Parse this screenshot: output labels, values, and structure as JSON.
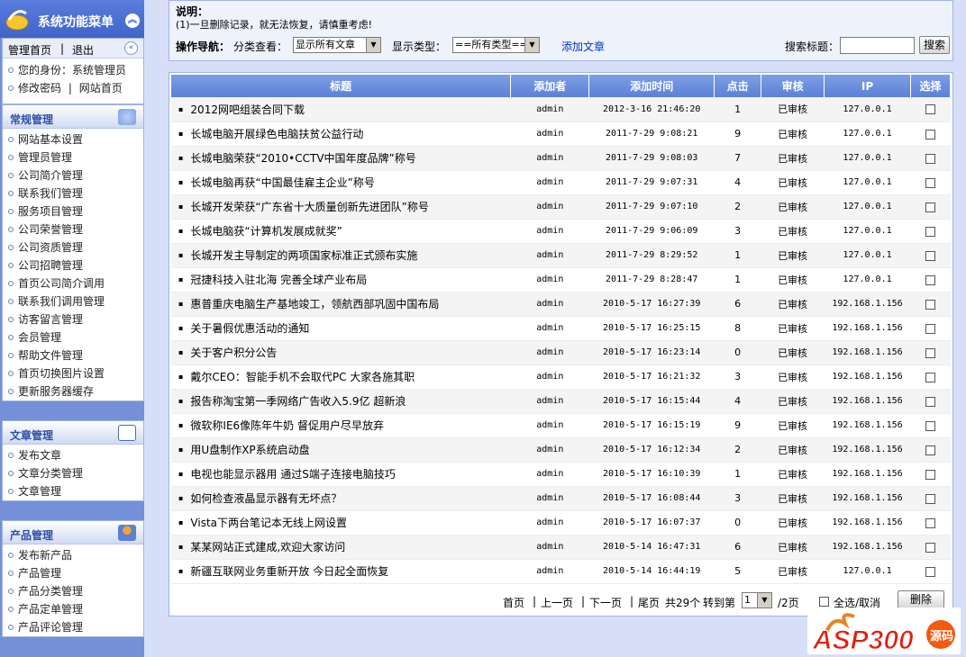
{
  "sidebar": {
    "title": "系统功能菜单",
    "user_nav": {
      "home": "管理首页",
      "sep": "|",
      "logout": "退出"
    },
    "identity": "您的身份：系统管理员",
    "change_pw": "修改密码",
    "sep": "|",
    "site_home": "网站首页",
    "panels": [
      {
        "title": "常规管理",
        "items": [
          "网站基本设置",
          "管理员管理",
          "公司简介管理",
          "联系我们管理",
          "服务项目管理",
          "公司荣誉管理",
          "公司资质管理",
          "公司招聘管理",
          "首页公司简介调用",
          "联系我们调用管理",
          "访客留言管理",
          "会员管理",
          "帮助文件管理",
          "首页切换图片设置",
          "更新服务器缓存"
        ]
      },
      {
        "title": "文章管理",
        "items": [
          "发布文章",
          "文章分类管理",
          "文章管理"
        ]
      },
      {
        "title": "产品管理",
        "items": [
          "发布新产品",
          "产品管理",
          "产品分类管理",
          "产品定单管理",
          "产品评论管理"
        ]
      }
    ]
  },
  "notice": {
    "title": "说明：",
    "text": "(1)一旦删除记录，就无法恢复，请慎重考虑!"
  },
  "toolbar": {
    "nav_label": "操作导航：",
    "category_label": "分类查看：",
    "category_value": "显示所有文章",
    "type_label": "显示类型：",
    "type_value": "==所有类型==",
    "add_link": "添加文章",
    "search_label": "搜索标题：",
    "search_value": "",
    "search_button": "搜索"
  },
  "table": {
    "headers": [
      "标题",
      "添加者",
      "添加时间",
      "点击",
      "审核",
      "IP",
      "选择"
    ],
    "rows": [
      {
        "title": "2012网吧组装合同下载",
        "author": "admin",
        "time": "2012-3-16 21:46:20",
        "clicks": "1",
        "status": "已审核",
        "ip": "127.0.0.1"
      },
      {
        "title": "长城电脑开展绿色电脑扶贫公益行动",
        "author": "admin",
        "time": "2011-7-29 9:08:21",
        "clicks": "9",
        "status": "已审核",
        "ip": "127.0.0.1"
      },
      {
        "title": "长城电脑荣获“2010•CCTV中国年度品牌”称号",
        "author": "admin",
        "time": "2011-7-29 9:08:03",
        "clicks": "7",
        "status": "已审核",
        "ip": "127.0.0.1"
      },
      {
        "title": "长城电脑再获“中国最佳雇主企业”称号",
        "author": "admin",
        "time": "2011-7-29 9:07:31",
        "clicks": "4",
        "status": "已审核",
        "ip": "127.0.0.1"
      },
      {
        "title": "长城开发荣获“广东省十大质量创新先进团队”称号",
        "author": "admin",
        "time": "2011-7-29 9:07:10",
        "clicks": "2",
        "status": "已审核",
        "ip": "127.0.0.1"
      },
      {
        "title": "长城电脑获“计算机发展成就奖”",
        "author": "admin",
        "time": "2011-7-29 9:06:09",
        "clicks": "3",
        "status": "已审核",
        "ip": "127.0.0.1"
      },
      {
        "title": "长城开发主导制定的两项国家标准正式颁布实施",
        "author": "admin",
        "time": "2011-7-29 8:29:52",
        "clicks": "1",
        "status": "已审核",
        "ip": "127.0.0.1"
      },
      {
        "title": "冠捷科技入驻北海 完善全球产业布局",
        "author": "admin",
        "time": "2011-7-29 8:28:47",
        "clicks": "1",
        "status": "已审核",
        "ip": "127.0.0.1"
      },
      {
        "title": "惠普重庆电脑生产基地竣工，领航西部巩固中国布局",
        "author": "admin",
        "time": "2010-5-17 16:27:39",
        "clicks": "6",
        "status": "已审核",
        "ip": "192.168.1.156"
      },
      {
        "title": "关于暑假优惠活动的通知",
        "author": "admin",
        "time": "2010-5-17 16:25:15",
        "clicks": "8",
        "status": "已审核",
        "ip": "192.168.1.156"
      },
      {
        "title": "关于客户积分公告",
        "author": "admin",
        "time": "2010-5-17 16:23:14",
        "clicks": "0",
        "status": "已审核",
        "ip": "192.168.1.156"
      },
      {
        "title": "戴尔CEO：智能手机不会取代PC 大家各施其职",
        "author": "admin",
        "time": "2010-5-17 16:21:32",
        "clicks": "3",
        "status": "已审核",
        "ip": "192.168.1.156"
      },
      {
        "title": "报告称淘宝第一季网络广告收入5.9亿 超新浪",
        "author": "admin",
        "time": "2010-5-17 16:15:44",
        "clicks": "4",
        "status": "已审核",
        "ip": "192.168.1.156"
      },
      {
        "title": "微软称IE6像陈年牛奶 督促用户尽早放弃",
        "author": "admin",
        "time": "2010-5-17 16:15:19",
        "clicks": "9",
        "status": "已审核",
        "ip": "192.168.1.156"
      },
      {
        "title": "用U盘制作XP系统启动盘",
        "author": "admin",
        "time": "2010-5-17 16:12:34",
        "clicks": "2",
        "status": "已审核",
        "ip": "192.168.1.156"
      },
      {
        "title": "电视也能显示器用 通过S端子连接电脑技巧",
        "author": "admin",
        "time": "2010-5-17 16:10:39",
        "clicks": "1",
        "status": "已审核",
        "ip": "192.168.1.156"
      },
      {
        "title": "如何检查液晶显示器有无坏点？",
        "author": "admin",
        "time": "2010-5-17 16:08:44",
        "clicks": "3",
        "status": "已审核",
        "ip": "192.168.1.156"
      },
      {
        "title": "Vista下两台笔记本无线上网设置",
        "author": "admin",
        "time": "2010-5-17 16:07:37",
        "clicks": "0",
        "status": "已审核",
        "ip": "192.168.1.156"
      },
      {
        "title": "某某网站正式建成,欢迎大家访问",
        "author": "admin",
        "time": "2010-5-14 16:47:31",
        "clicks": "6",
        "status": "已审核",
        "ip": "192.168.1.156"
      },
      {
        "title": "新疆互联网业务重新开放 今日起全面恢复",
        "author": "admin",
        "time": "2010-5-14 16:44:19",
        "clicks": "5",
        "status": "已审核",
        "ip": "127.0.0.1"
      }
    ]
  },
  "pager": {
    "first": "首页",
    "prev": "上一页",
    "next": "下一页",
    "last": "尾页",
    "total": "共29个",
    "goto": "转到第",
    "page_value": "1",
    "pages": "/2页",
    "select_all": "全选/取消",
    "delete": "删除",
    "sep": "|"
  },
  "watermark": {
    "text": "ASP300",
    "sub": "源码"
  }
}
